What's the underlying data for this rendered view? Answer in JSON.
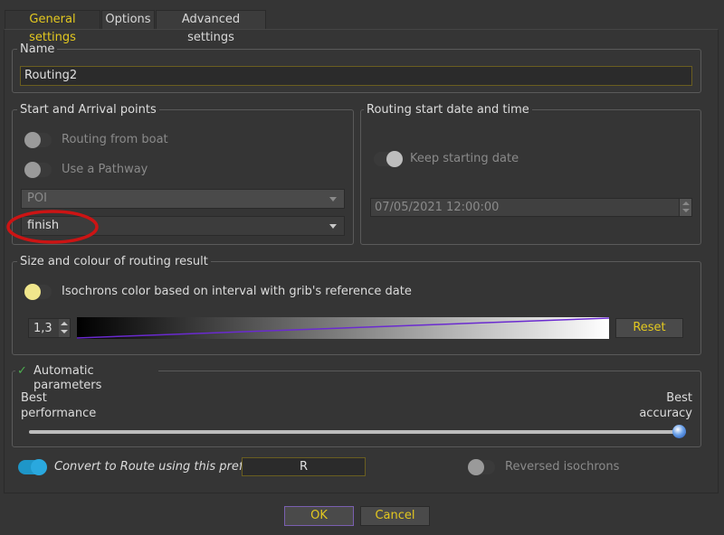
{
  "tabs": [
    {
      "label": "General settings"
    },
    {
      "label": "Options"
    },
    {
      "label": "Advanced settings"
    }
  ],
  "name_group": {
    "title": "Name",
    "value": "Routing2"
  },
  "start_arrival": {
    "title": "Start and Arrival points",
    "routing_from_boat": "Routing from boat",
    "use_pathway": "Use a Pathway",
    "poi_combo": "POI",
    "finish_combo": "finish"
  },
  "routing_start": {
    "title": "Routing start date and time",
    "keep_starting_date": "Keep starting date",
    "date_value": "07/05/2021 12:00:00"
  },
  "size_colour": {
    "title": "Size and colour of routing result",
    "isochrons_label": "Isochrons color based on interval with grib's reference date",
    "width_value": "1,3",
    "reset": "Reset"
  },
  "auto_params": {
    "title": "Automatic parameters",
    "best_performance_1": "Best",
    "best_performance_2": "performance",
    "best_accuracy_1": "Best",
    "best_accuracy_2": "accuracy",
    "slider_level": 1.0
  },
  "convert": {
    "label": "Convert to Route using this prefix",
    "prefix": "R"
  },
  "reversed": {
    "label": "Reversed isochrons"
  },
  "buttons": {
    "ok": "OK",
    "cancel": "Cancel"
  },
  "colors": {
    "accent": "#e3c820",
    "toggle_on": "#1e96c8",
    "highlight": "#cc1414",
    "gradient_line": "#6a2ad0"
  }
}
